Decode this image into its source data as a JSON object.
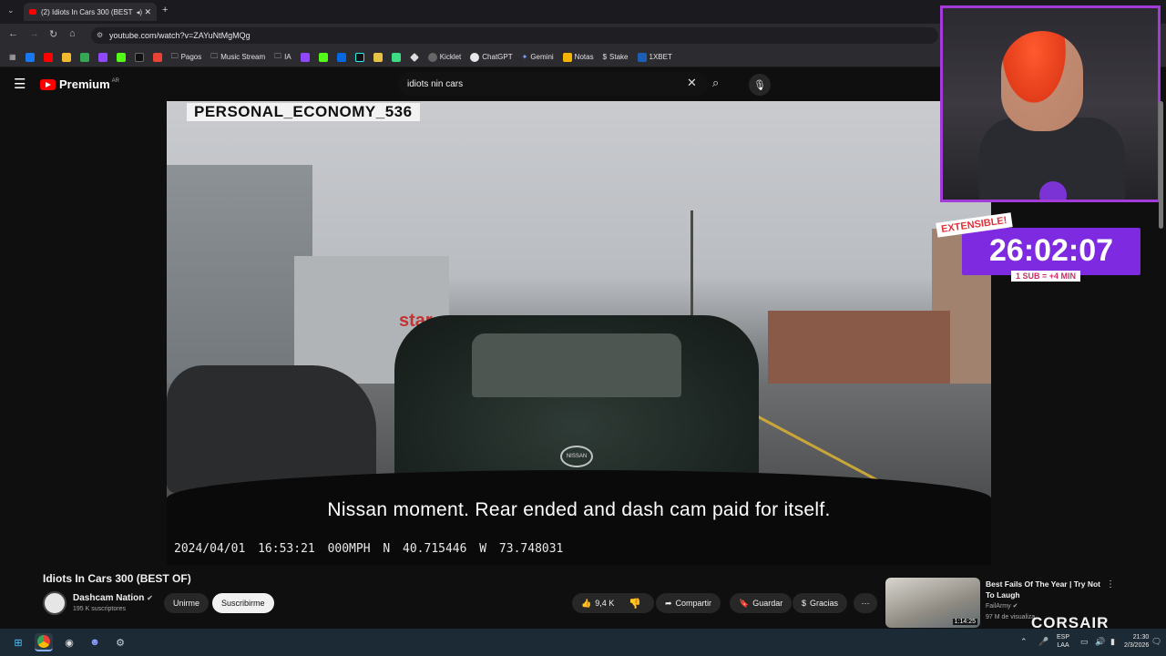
{
  "browser": {
    "tab_title": "(2) Idiots In Cars 300 (BEST",
    "url": "youtube.com/watch?v=ZAYuNtMgMQg",
    "bookmarks": [
      "Pagos",
      "Music Stream",
      "IA",
      "Kicklet",
      "ChatGPT",
      "Gemini",
      "Notas",
      "Stake",
      "1XBET"
    ]
  },
  "youtube": {
    "logo_text": "Premium",
    "region": "AR",
    "search_query": "idiots nin cars"
  },
  "video": {
    "channel_watermark": "PERSONAL_ECONOMY_536",
    "subtitle": "Nissan moment. Rear ended and dash cam paid for itself.",
    "stamp_date": "2024/04/01",
    "stamp_time": "16:53:21",
    "stamp_speed": "000MPH",
    "stamp_lat": "N 40.715446",
    "stamp_lon": "W 73.748031",
    "car_badge": "NISSAN",
    "shop_sign": "star"
  },
  "overlay": {
    "badge": "EXTENSIBLE!",
    "timer": "26:02:07",
    "sub_rate": "1 SUB = +4 MIN"
  },
  "info": {
    "title": "Idiots In Cars 300 (BEST OF)",
    "channel": "Dashcam Nation",
    "subscribers": "195 K suscriptores",
    "join_label": "Unirme",
    "subscribe_label": "Suscribirme",
    "likes": "9,4 K",
    "share_label": "Compartir",
    "save_label": "Guardar",
    "thanks_label": "Gracias"
  },
  "recommended": {
    "title": "Best Fails Of The Year | Try Not To Laugh",
    "channel": "FailArmy",
    "views": "97 M de visualiza",
    "duration": "1:14:25"
  },
  "brand": "CORSAIR",
  "taskbar": {
    "lang_top": "ESP",
    "lang_bottom": "LAA",
    "time": "21:30",
    "date": "2/3/2026"
  },
  "colors": {
    "accent_purple": "#7d2ae0",
    "youtube_red": "#ff0000",
    "timer_border": "#a23bd8"
  }
}
